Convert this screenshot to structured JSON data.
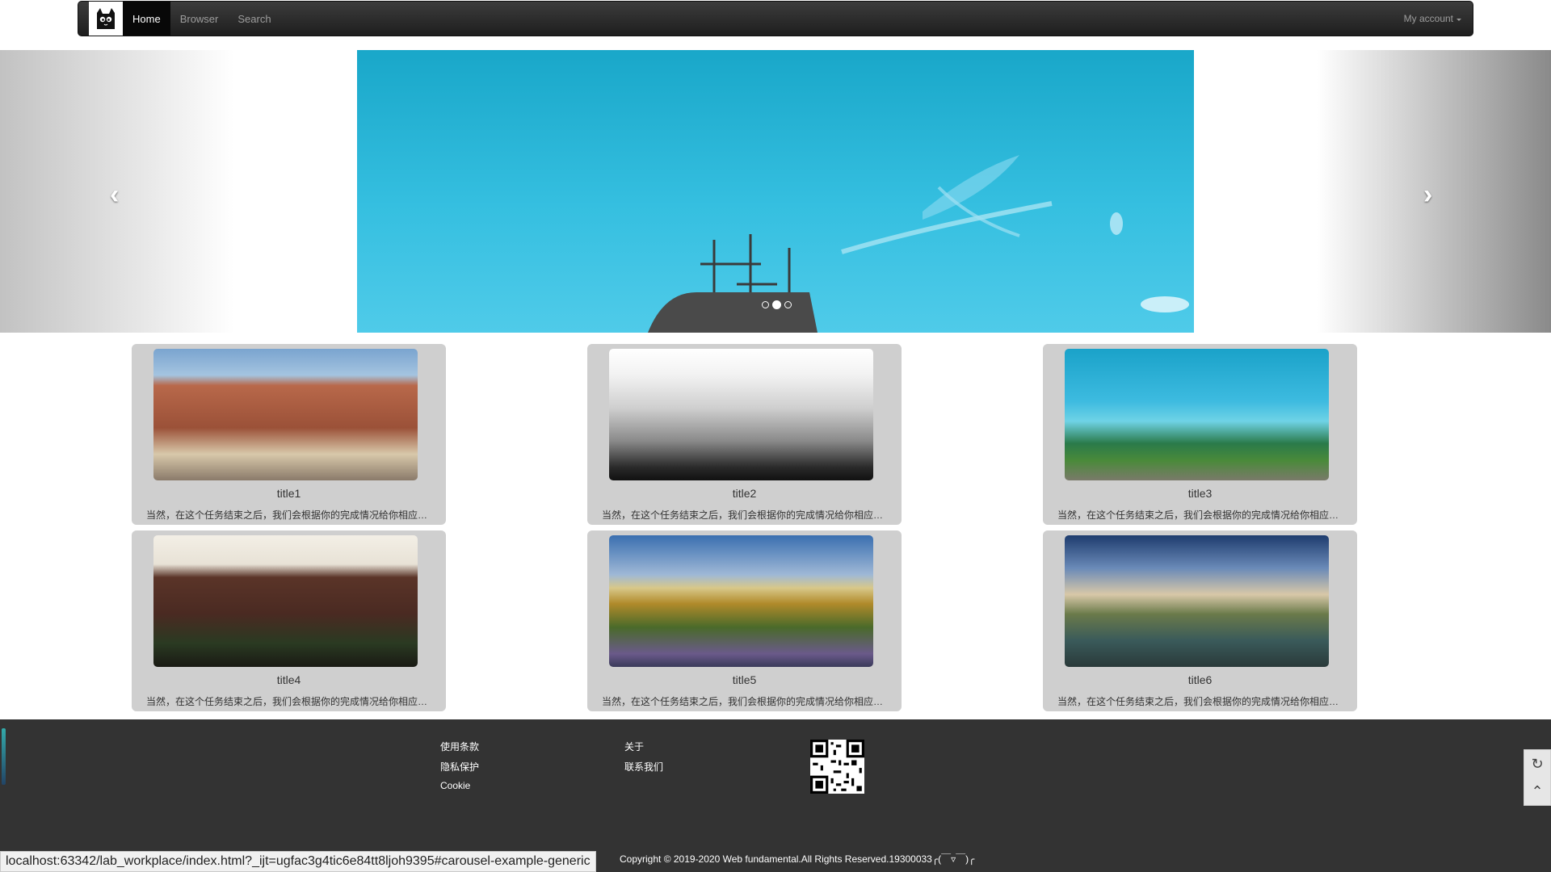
{
  "navbar": {
    "logo": "cat-logo",
    "items": [
      {
        "label": "Home",
        "active": true
      },
      {
        "label": "Browser",
        "active": false
      },
      {
        "label": "Search",
        "active": false
      }
    ],
    "account_label": "My account"
  },
  "carousel": {
    "prev_icon": "chevron-left-icon",
    "next_icon": "chevron-right-icon",
    "active_index": 1,
    "slide_count": 3
  },
  "cards": [
    {
      "title": "title1",
      "desc": "当然，在这个任务结束之后，我们会根据你的完成情况给你相应的..."
    },
    {
      "title": "title2",
      "desc": "当然，在这个任务结束之后，我们会根据你的完成情况给你相应的..."
    },
    {
      "title": "title3",
      "desc": "当然，在这个任务结束之后，我们会根据你的完成情况给你相应的..."
    },
    {
      "title": "title4",
      "desc": "当然，在这个任务结束之后，我们会根据你的完成情况给你相应的..."
    },
    {
      "title": "title5",
      "desc": "当然，在这个任务结束之后，我们会根据你的完成情况给你相应的..."
    },
    {
      "title": "title6",
      "desc": "当然，在这个任务结束之后，我们会根据你的完成情况给你相应的..."
    }
  ],
  "footer": {
    "col1": [
      "使用条款",
      "隐私保护",
      "Cookie"
    ],
    "col2": [
      "关于",
      "联系我们"
    ],
    "qr_icon": "qr-code-icon",
    "copyright": "Copyright © 2019-2020 Web fundamental.All Rights Reserved.19300033╭(￣▿￣)╭"
  },
  "status_url": "localhost:63342/lab_workplace/index.html?_ijt=ugfac3g4tic6e84tt8ljoh9395#carousel-example-generic",
  "colors": {
    "navbar": "#222222",
    "footer": "#333333",
    "card": "#cfcfcf",
    "sky": "#2fb8da"
  }
}
